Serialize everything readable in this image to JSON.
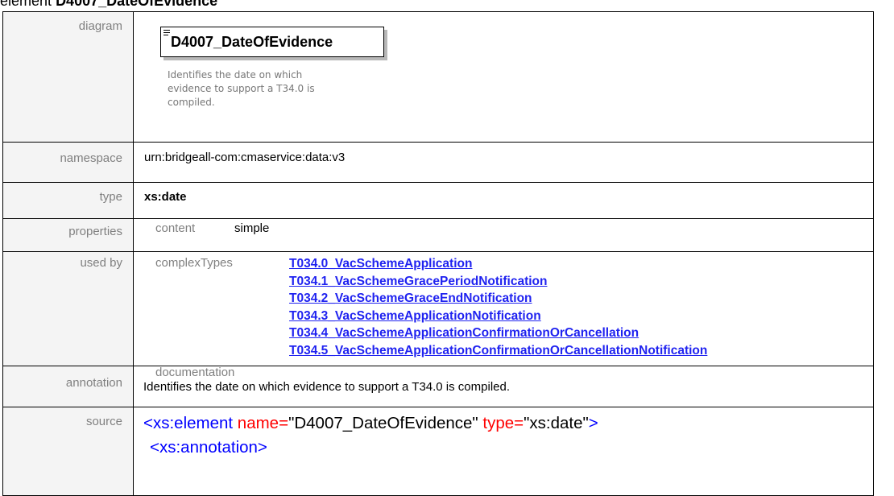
{
  "heading": {
    "prefix": "element",
    "name": "D4007_DateOfEvidence"
  },
  "labels": {
    "diagram": "diagram",
    "namespace": "namespace",
    "type": "type",
    "properties": "properties",
    "used_by": "used by",
    "annotation": "annotation",
    "source": "source"
  },
  "diagram": {
    "element_name": "D4007_DateOfEvidence",
    "documentation_lines": [
      "Identifies the date on which",
      "evidence to support a T34.0 is",
      "compiled."
    ]
  },
  "namespace": "urn:bridgeall-com:cmaservice:data:v3",
  "type": "xs:date",
  "properties": {
    "content_label": "content",
    "content_value": "simple"
  },
  "used_by": {
    "group_label": "complexTypes",
    "links": [
      "T034.0_VacSchemeApplication",
      "T034.1_VacSchemeGracePeriodNotification",
      "T034.2_VacSchemeGraceEndNotification",
      "T034.3_VacSchemeApplicationNotification",
      "T034.4_VacSchemeApplicationConfirmationOrCancellation",
      "T034.5_VacSchemeApplicationConfirmationOrCancellationNotification"
    ]
  },
  "annotation": {
    "label": "documentation",
    "text": "Identifies the date on which evidence to support a T34.0 is compiled."
  },
  "source": {
    "line1": {
      "open": "<xs:element",
      "attr1_name": " name=",
      "attr1_value": "\"D4007_DateOfEvidence\"",
      "attr2_name": " type=",
      "attr2_value": "\"xs:date\"",
      "close": ">"
    },
    "line2": "<xs:annotation>"
  },
  "colors": {
    "link": "#1f22f0",
    "tag": "#0000ff",
    "attr": "#ff0000",
    "label_bg": "#f4f4f4",
    "label_text": "#808080"
  }
}
